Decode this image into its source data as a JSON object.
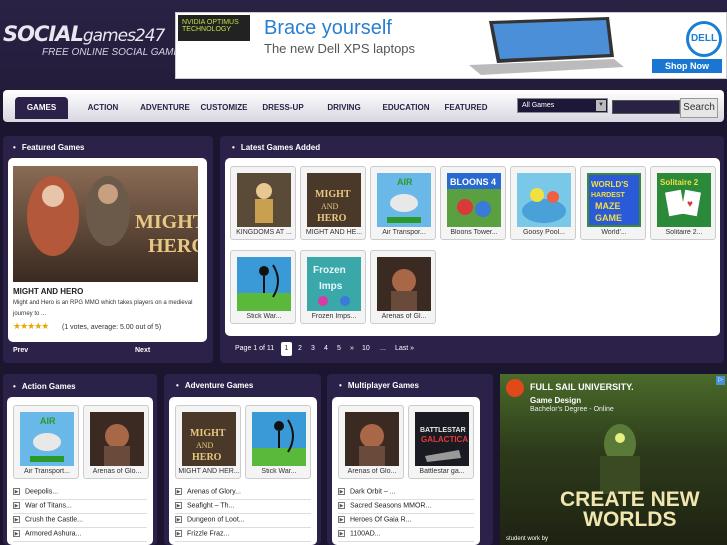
{
  "header": {
    "logo_main": "SOCIAL",
    "logo_suffix": "games247",
    "tagline": "FREE ONLINE SOCIAL GAMES"
  },
  "ad_top": {
    "badge": "NVIDIA OPTIMUS TECHNOLOGY",
    "headline": "Brace yourself",
    "subline": "The new Dell XPS laptops",
    "brand": "DELL",
    "cta": "Shop Now"
  },
  "nav": {
    "items": [
      "GAMES",
      "ACTION",
      "ADVENTURE",
      "CUSTOMIZE",
      "DRESS-UP",
      "DRIVING",
      "EDUCATION",
      "FEATURED"
    ],
    "category_select": "All Games",
    "search_button": "Search"
  },
  "featured": {
    "title": "Featured Games",
    "game_title": "MIGHT AND HERO",
    "game_image_text": "MIGHT AND HERO",
    "description": "Might and Hero is an RPG MMO which takes players on a medieval journey to ...",
    "rating": 5.0,
    "rating_text": "(1 votes, average: 5.00 out of 5)",
    "prev": "Prev",
    "next": "Next"
  },
  "latest": {
    "title": "Latest Games Added",
    "games": [
      {
        "caption": "KINGDOMS AT ..."
      },
      {
        "caption": "MIGHT AND HE..."
      },
      {
        "caption": "Air Transpor..."
      },
      {
        "caption": "Bloons Tower..."
      },
      {
        "caption": "Goosy Pool..."
      },
      {
        "caption": "World'..."
      },
      {
        "caption": "Solitaire 2..."
      },
      {
        "caption": "Stick War..."
      },
      {
        "caption": "Frozen Imps..."
      },
      {
        "caption": "Arenas of Gl..."
      }
    ],
    "pager": {
      "label": "Page 1 of 11",
      "pages": [
        "1",
        "2",
        "3",
        "4",
        "5",
        "»",
        "10",
        "...",
        "Last »"
      ]
    }
  },
  "action": {
    "title": "Action Games",
    "games": [
      {
        "caption": "Air Transport..."
      },
      {
        "caption": "Arenas of Glo..."
      }
    ],
    "list": [
      "Deepolis...",
      "War of Titans...",
      "Crush the Castle...",
      "Armored Ashura..."
    ]
  },
  "adventure": {
    "title": "Adventure Games",
    "games": [
      {
        "caption": "MIGHT AND HER..."
      },
      {
        "caption": "Stick War..."
      }
    ],
    "list": [
      "Arenas of Glory...",
      "Seafight – Th...",
      "Dungeon of Loot...",
      "Frizzle Fraz..."
    ]
  },
  "multiplayer": {
    "title": "Multiplayer Games",
    "games": [
      {
        "caption": "Arenas of Glo..."
      },
      {
        "caption": "Battlestar ga..."
      }
    ],
    "list": [
      "Dark Orbit – ...",
      "Sacred Seasons MMOR...",
      "Heroes Of Gaia R...",
      "1100AD..."
    ]
  },
  "ad_side": {
    "brand": "FULL SAIL UNIVERSITY.",
    "program": "Game Design",
    "degree": "Bachelor's Degree - Online",
    "slogan_line1": "CREATE NEW",
    "slogan_line2": "WORLDS",
    "footer": "student work by"
  },
  "colors": {
    "background": "#1b1530",
    "panel": "#2c2148",
    "accent_blue": "#2a7fd0"
  }
}
